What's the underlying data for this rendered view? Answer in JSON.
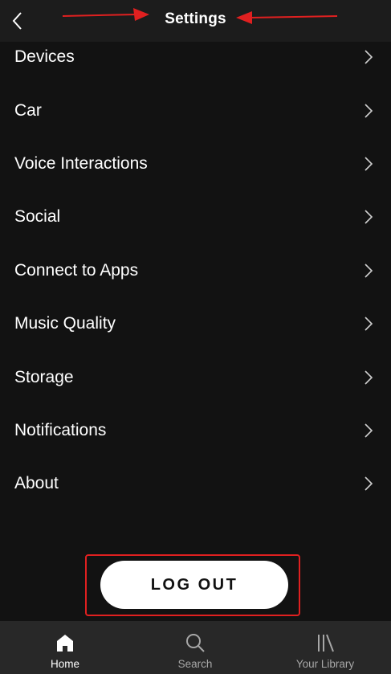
{
  "header": {
    "title": "Settings",
    "back_icon": "chevron-left-icon"
  },
  "settings_items": [
    {
      "label": "Devices"
    },
    {
      "label": "Car"
    },
    {
      "label": "Voice Interactions"
    },
    {
      "label": "Social"
    },
    {
      "label": "Connect to Apps"
    },
    {
      "label": "Music Quality"
    },
    {
      "label": "Storage"
    },
    {
      "label": "Notifications"
    },
    {
      "label": "About"
    }
  ],
  "logout": {
    "label": "LOG OUT"
  },
  "tabbar": {
    "tabs": [
      {
        "label": "Home",
        "icon": "home-icon",
        "active": true
      },
      {
        "label": "Search",
        "icon": "search-icon",
        "active": false
      },
      {
        "label": "Your Library",
        "icon": "library-icon",
        "active": false
      }
    ]
  },
  "colors": {
    "background": "#121212",
    "header": "#1c1c1c",
    "tabbar": "#282828",
    "annotation": "#e02020",
    "button": "#ffffff"
  }
}
